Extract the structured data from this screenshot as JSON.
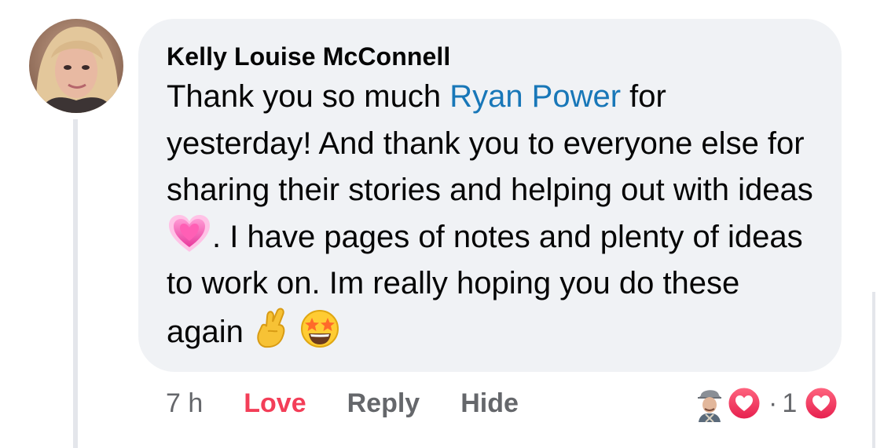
{
  "comment": {
    "author": "Kelly Louise McConnell",
    "text_part1": "Thank you so much ",
    "mention": "Ryan Power",
    "text_part2": " for yesterday! And thank you to everyone else for sharing their stories and helping out with ideas ",
    "emoji1": "growing-heart-emoji",
    "text_part3": ". I have pages of notes and plenty of ideas to work on. Im really hoping you do these again ",
    "emoji2": "crossed-fingers-emoji",
    "emoji3": "star-struck-emoji"
  },
  "actions": {
    "time": "7 h",
    "love": "Love",
    "reply": "Reply",
    "hide": "Hide"
  },
  "reactions": {
    "dot": "·",
    "count": "1",
    "reaction_icon": "love-heart-icon"
  },
  "colors": {
    "bubble": "#f0f2f5",
    "mention": "#1877b8",
    "love": "#f33e58",
    "muted": "#65676b"
  }
}
